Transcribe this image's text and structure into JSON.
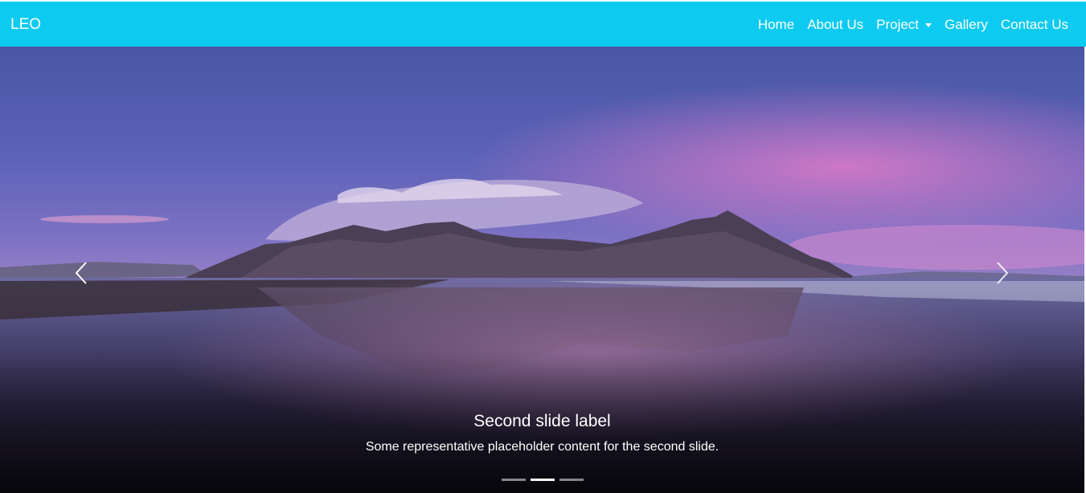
{
  "navbar": {
    "brand": "LEO",
    "bg_color": "#0dcaf0",
    "items": [
      {
        "label": "Home"
      },
      {
        "label": "About Us"
      },
      {
        "label": "Project",
        "dropdown": true
      },
      {
        "label": "Gallery"
      },
      {
        "label": "Contact Us"
      }
    ]
  },
  "carousel": {
    "active_index": 1,
    "indicator_count": 3,
    "caption": {
      "title": "Second slide label",
      "text": "Some representative placeholder content for the second slide."
    },
    "controls": {
      "prev_icon": "chevron-left-icon",
      "next_icon": "chevron-right-icon"
    },
    "image": {
      "subject": "mountain-beach-reflection-at-dusk",
      "colors": {
        "sky_top": "#4e5aa8",
        "sky_mid": "#6b6ac2",
        "pink_glow": "#d77ac6",
        "mountain": "#4a3f55",
        "water_dark": "#1a1524"
      }
    }
  }
}
